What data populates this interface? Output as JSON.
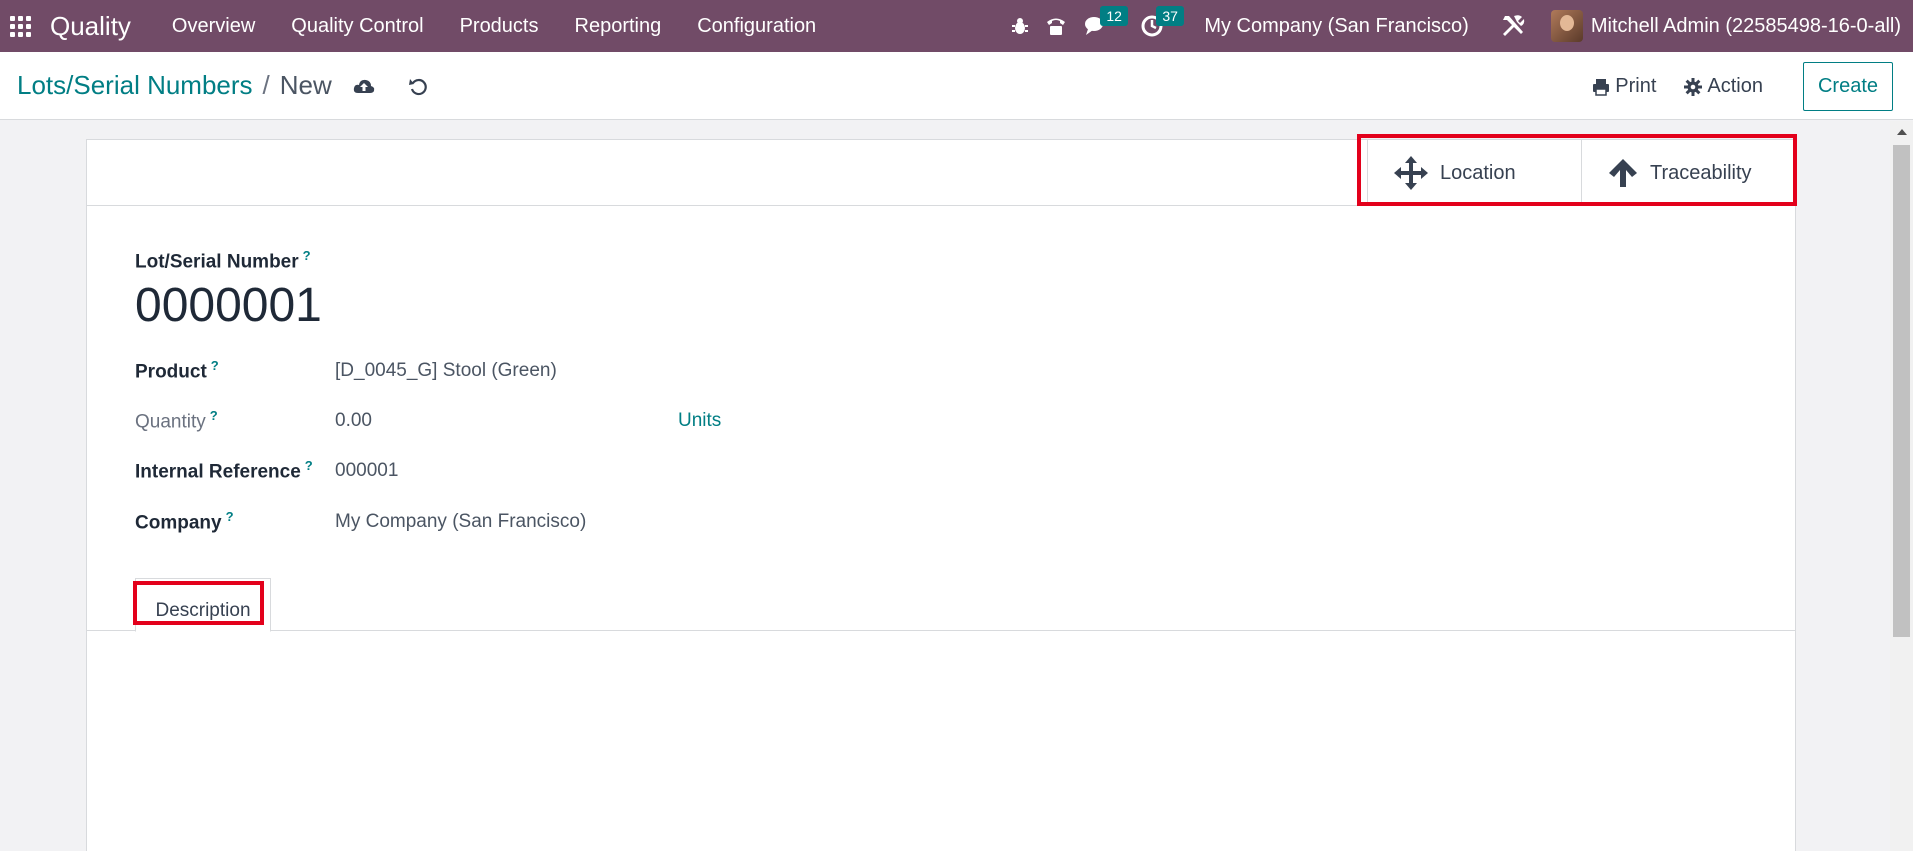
{
  "navbar": {
    "app_name": "Quality",
    "menu": [
      "Overview",
      "Quality Control",
      "Products",
      "Reporting",
      "Configuration"
    ],
    "messages_count": "12",
    "activities_count": "37",
    "company": "My Company (San Francisco)",
    "user": "Mitchell Admin (22585498-16-0-all)"
  },
  "breadcrumb": {
    "parent": "Lots/Serial Numbers",
    "separator": "/",
    "current": "New"
  },
  "control_panel": {
    "print_label": "Print",
    "action_label": "Action",
    "create_label": "Create"
  },
  "smart_buttons": {
    "location_label": "Location",
    "traceability_label": "Traceability"
  },
  "form": {
    "lot_label": "Lot/Serial Number",
    "lot_value": "0000001",
    "help_mark": "?",
    "product_label": "Product",
    "product_value": "[D_0045_G] Stool (Green)",
    "quantity_label": "Quantity",
    "quantity_value": "0.00",
    "quantity_uom": "Units",
    "internal_ref_label": "Internal Reference",
    "internal_ref_value": "000001",
    "company_label": "Company",
    "company_value": "My Company (San Francisco)"
  },
  "tabs": {
    "description_label": "Description"
  },
  "colors": {
    "navbar": "#714b67",
    "accent": "#017e84",
    "highlight": "#e3001b"
  }
}
